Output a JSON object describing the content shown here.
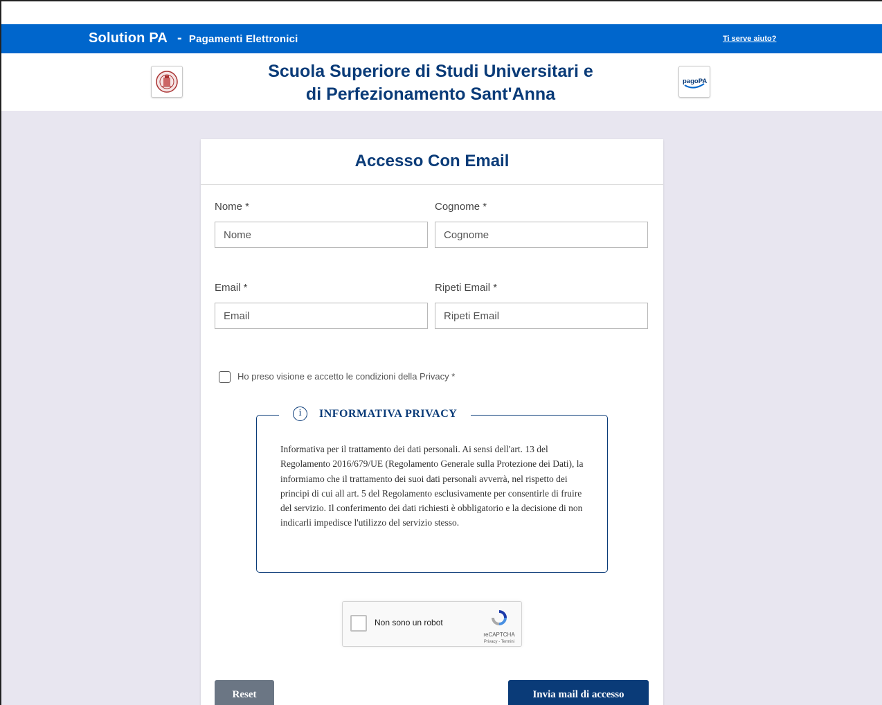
{
  "topbar": {
    "brand": "Solution PA",
    "separator": "-",
    "subtitle": "Pagamenti Elettronici",
    "help_link": "Ti serve aiuto?",
    "color": "#0066cc"
  },
  "header": {
    "org_line1": "Scuola Superiore di Studi Universitari e",
    "org_line2": "di Perfezionamento Sant'Anna",
    "left_logo": "university-seal-icon",
    "right_logo": "pagopa-logo-icon",
    "pagopa_text": "pagoPA"
  },
  "form": {
    "title": "Accesso Con Email",
    "fields": {
      "nome": {
        "label": "Nome *",
        "placeholder": "Nome"
      },
      "cognome": {
        "label": "Cognome *",
        "placeholder": "Cognome"
      },
      "email": {
        "label": "Email *",
        "placeholder": "Email"
      },
      "ripeti_email": {
        "label": "Ripeti Email *",
        "placeholder": "Ripeti Email"
      }
    },
    "privacy_checkbox_label": "Ho preso visione e accetto le condizioni della Privacy *",
    "privacy_info": {
      "icon": "info-icon",
      "title": "INFORMATIVA PRIVACY",
      "text": "Informativa per il trattamento dei dati personali. Ai sensi dell'art. 13 del Regolamento 2016/679/UE (Regolamento Generale sulla Protezione dei Dati), la informiamo che il trattamento dei suoi dati personali avverrà, nel rispetto dei principi di cui all art. 5 del Regolamento esclusivamente per consentirle di fruire del servizio. Il conferimento dei dati richiesti è obbligatorio e la decisione di non indicarli impedisce l'utilizzo del servizio stesso."
    },
    "captcha": {
      "label": "Non sono un robot",
      "brand": "reCAPTCHA",
      "links": "Privacy - Termini"
    },
    "reset_label": "Reset",
    "send_label": "Invia mail di accesso"
  },
  "colors": {
    "primary_dark": "#0a3b78",
    "page_background": "#e8e6f0",
    "reset_button": "#6b7684"
  }
}
